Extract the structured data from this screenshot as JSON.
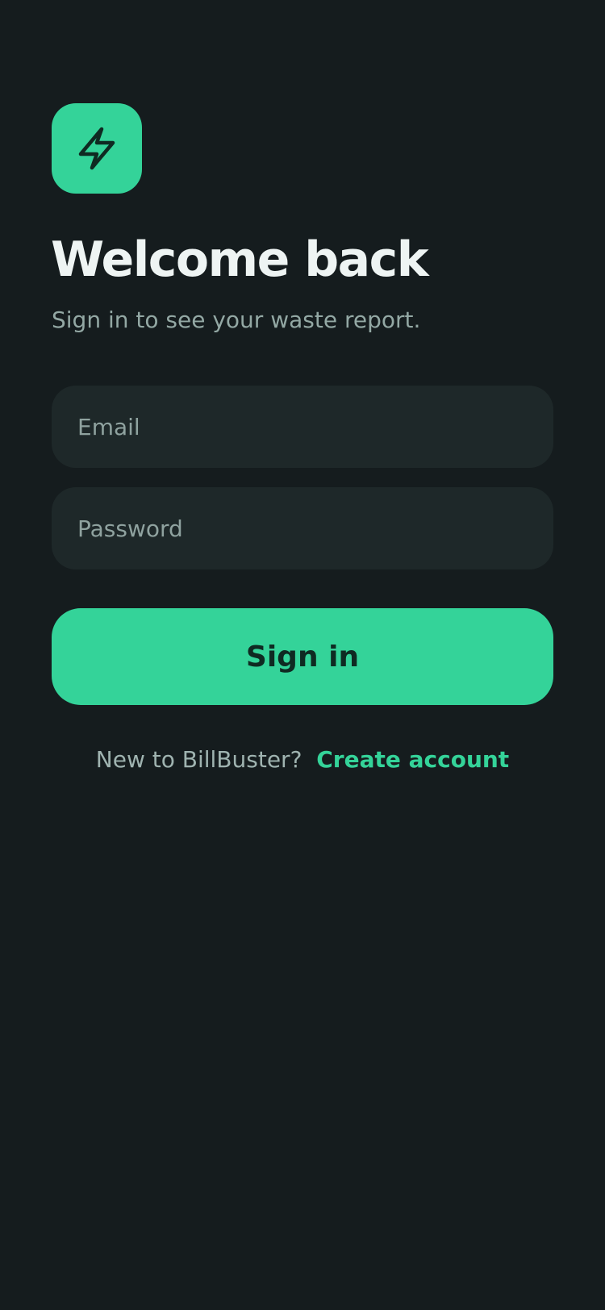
{
  "logo": {
    "icon": "bolt-icon",
    "accent": "#34d399"
  },
  "header": {
    "title": "Welcome back",
    "subtitle": "Sign in to see your waste report."
  },
  "form": {
    "email_placeholder": "Email",
    "password_placeholder": "Password",
    "submit_label": "Sign in"
  },
  "footer": {
    "prompt": "New to BillBuster?",
    "link_label": "Create account"
  },
  "colors": {
    "background": "#151c1e",
    "field": "#1e2829",
    "accent": "#34d399",
    "title": "#eef4f3",
    "muted": "#93a8a4"
  }
}
